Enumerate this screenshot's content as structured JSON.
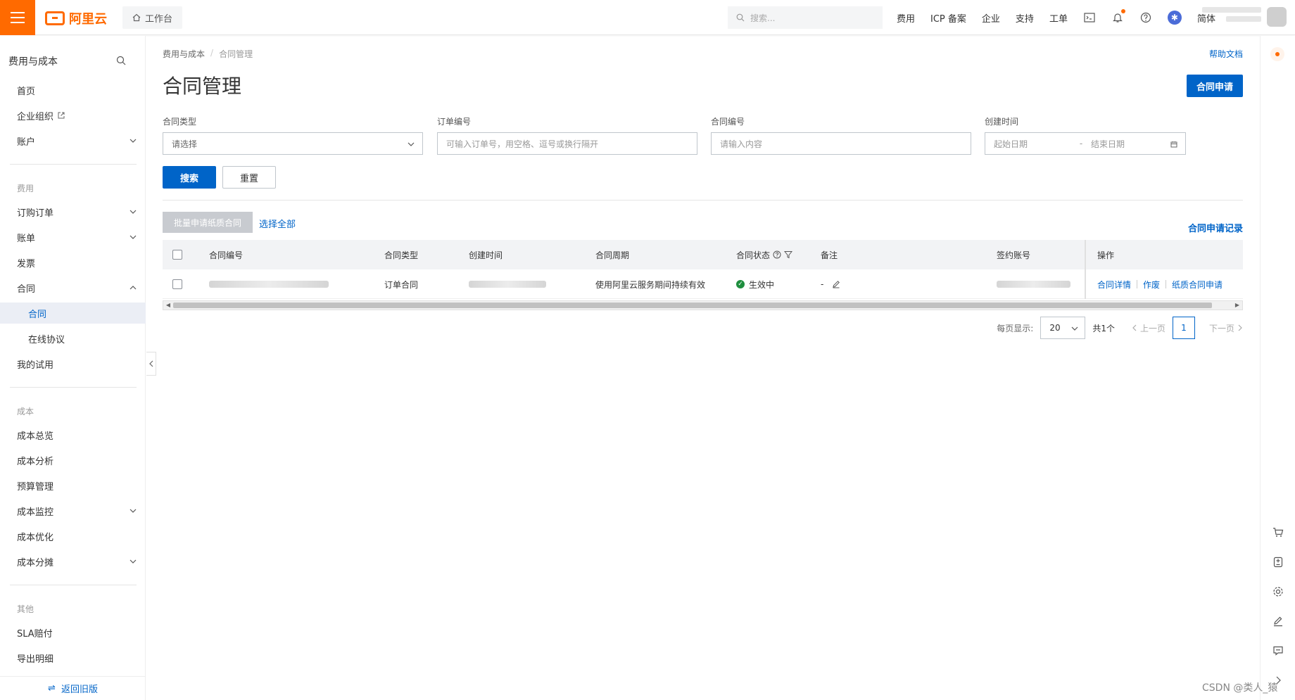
{
  "topbar": {
    "logo_text": "阿里云",
    "workbench": "工作台",
    "search_placeholder": "搜索...",
    "links": [
      "费用",
      "ICP 备案",
      "企业",
      "支持",
      "工单"
    ],
    "lang": "简体"
  },
  "sidebar": {
    "title": "费用与成本",
    "items": [
      {
        "label": "首页"
      },
      {
        "label": "企业组织"
      },
      {
        "label": "账户"
      }
    ],
    "group_fee": "费用",
    "fee_items": [
      {
        "label": "订购订单"
      },
      {
        "label": "账单"
      },
      {
        "label": "发票"
      },
      {
        "label": "合同"
      },
      {
        "label": "合同"
      },
      {
        "label": "在线协议"
      },
      {
        "label": "我的试用"
      }
    ],
    "group_cost": "成本",
    "cost_items": [
      {
        "label": "成本总览"
      },
      {
        "label": "成本分析"
      },
      {
        "label": "预算管理"
      },
      {
        "label": "成本监控"
      },
      {
        "label": "成本优化"
      },
      {
        "label": "成本分摊"
      }
    ],
    "group_other": "其他",
    "other_items": [
      {
        "label": "SLA赔付"
      },
      {
        "label": "导出明细"
      }
    ],
    "footer": "返回旧版"
  },
  "main": {
    "breadcrumb": [
      "费用与成本",
      "合同管理"
    ],
    "help": "帮助文档",
    "title": "合同管理",
    "apply_button": "合同申请",
    "filters": {
      "type_label": "合同类型",
      "type_value": "请选择",
      "order_label": "订单编号",
      "order_placeholder": "可输入订单号，用空格、逗号或换行隔开",
      "contract_label": "合同编号",
      "contract_placeholder": "请输入内容",
      "time_label": "创建时间",
      "start_placeholder": "起始日期",
      "end_placeholder": "结束日期",
      "range_sep": "-"
    },
    "search_button": "搜索",
    "reset_button": "重置",
    "batch_button": "批量申请纸质合同",
    "select_all": "选择全部",
    "records_link": "合同申请记录",
    "table": {
      "headers": [
        "合同编号",
        "合同类型",
        "创建时间",
        "合同周期",
        "合同状态",
        "备注",
        "签约账号",
        "操作"
      ],
      "rows": [
        {
          "type": "订单合同",
          "period": "使用阿里云服务期间持续有效",
          "status": "生效中",
          "remark": "-",
          "actions": [
            "合同详情",
            "作废",
            "纸质合同申请"
          ]
        }
      ]
    },
    "pager": {
      "page_size_label": "每页显示:",
      "page_size": "20",
      "total": "共1个",
      "prev": "上一页",
      "current": "1",
      "next": "下一页"
    }
  },
  "watermark": "CSDN @类人_猿",
  "colors": {
    "brand": "#ff6a00",
    "primary": "#0064c8",
    "success": "#1e8e3e"
  }
}
